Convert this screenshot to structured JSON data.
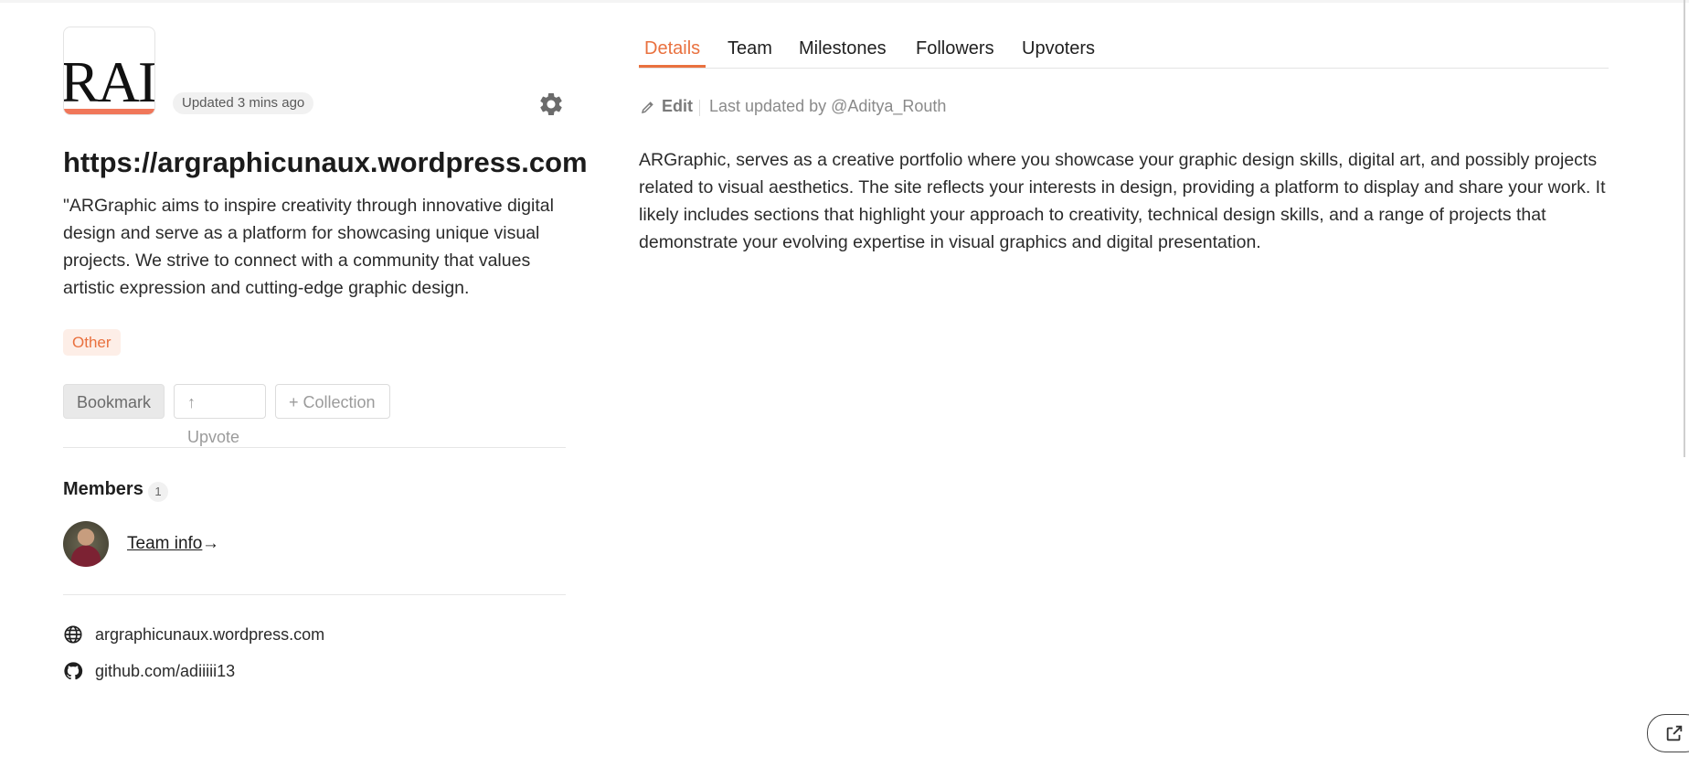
{
  "project": {
    "logo_text": "RAI",
    "updated": "Updated 3 mins ago",
    "title": "https://argraphicunaux.wordpress.com",
    "tagline": "\"ARGraphic aims to inspire creativity through innovative digital design and serve as a platform for showcasing unique visual projects. We strive to connect with a community that values artistic expression and cutting-edge graphic design.",
    "tag": "Other"
  },
  "actions": {
    "bookmark": "Bookmark",
    "upvote": "↑ Upvote",
    "collection": "+ Collection"
  },
  "members": {
    "label": "Members",
    "count": "1",
    "team_info": "Team info",
    "arrow": "→"
  },
  "links": {
    "website": "argraphicunaux.wordpress.com",
    "github": "github.com/adiiiii13"
  },
  "tabs": [
    "Details",
    "Team",
    "Milestones",
    "Followers",
    "Upvoters"
  ],
  "details": {
    "edit_label": "Edit",
    "last_updated": "Last updated by @Aditya_Routh",
    "description": "ARGraphic, serves as a creative portfolio where you showcase your graphic design skills, digital art, and possibly projects related to visual aesthetics. The site reflects your interests in design, providing a platform to display and share your work. It likely includes sections that highlight your approach to creativity, technical design skills, and a range of projects that demonstrate your evolving expertise in visual graphics and digital presentation."
  },
  "icons": {
    "settings": "gear-icon",
    "website": "globe-icon",
    "github": "github-icon",
    "edit": "pencil-icon",
    "share": "share-icon"
  },
  "colors": {
    "accent": "#e9713f",
    "tag_bg": "#fdeee7",
    "logo_bar": "#f0775a"
  }
}
